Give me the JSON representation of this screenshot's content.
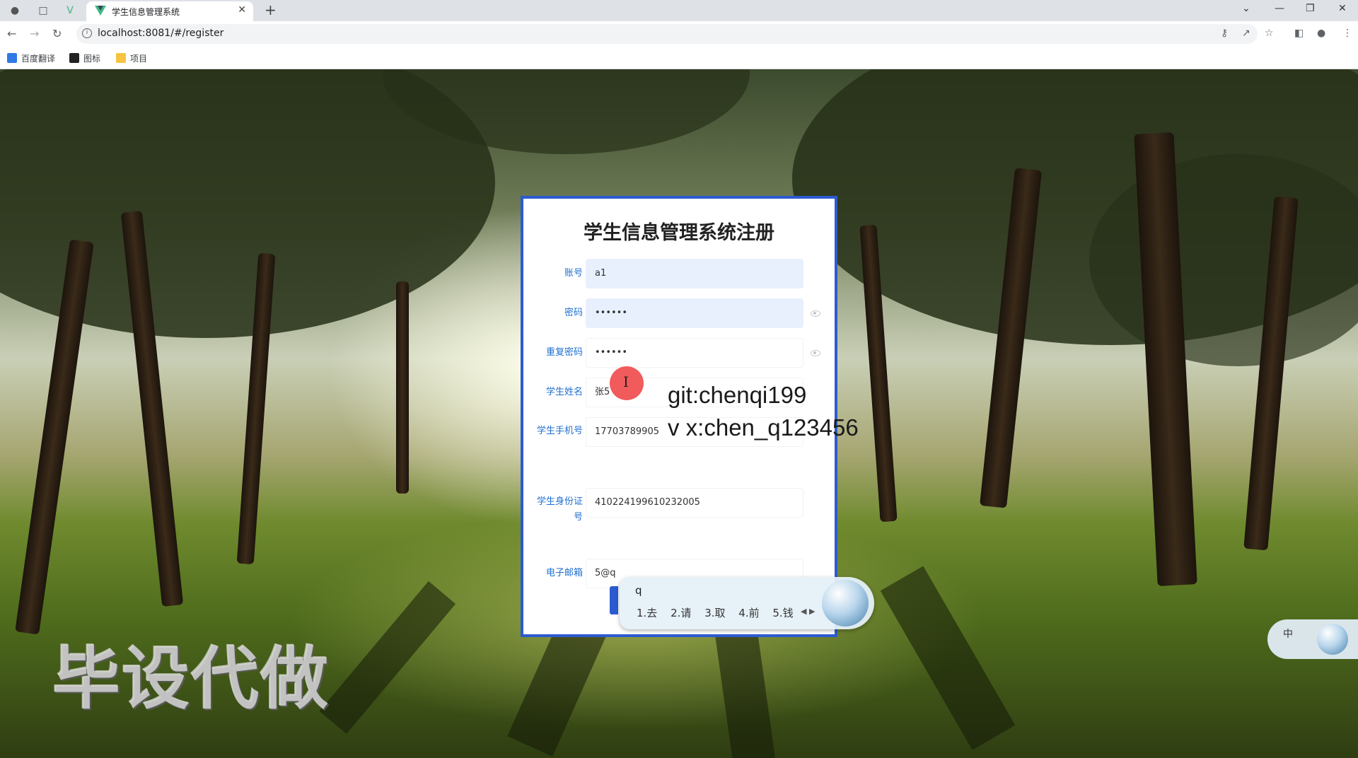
{
  "browser": {
    "tab_title": "学生信息管理系统",
    "url": "localhost:8081/#/register",
    "bookmarks": [
      "百度翻译",
      "图标",
      "项目"
    ]
  },
  "form": {
    "title": "学生信息管理系统注册",
    "fields": [
      {
        "label": "账号",
        "value": "a1"
      },
      {
        "label": "密码",
        "value": "••••••"
      },
      {
        "label": "重复密码",
        "value": "••••••"
      },
      {
        "label": "学生姓名",
        "value": "张5"
      },
      {
        "label": "学生手机号",
        "value": "17703789905"
      },
      {
        "label": "学生身份证号",
        "value": "410224199610232005"
      },
      {
        "label": "电子邮箱",
        "value": "5@q"
      }
    ]
  },
  "ime": {
    "input": "q",
    "candidates": [
      "1.去",
      "2.请",
      "3.取",
      "4.前",
      "5.钱"
    ],
    "status": "中"
  },
  "watermarks": {
    "git": "git:chenqi199",
    "wechat": "v x:chen_q123456",
    "big_text": "毕设代做"
  },
  "colors": {
    "accent": "#2c5bd1",
    "label": "#1f6fd1",
    "autofill": "#e8f0fe"
  }
}
